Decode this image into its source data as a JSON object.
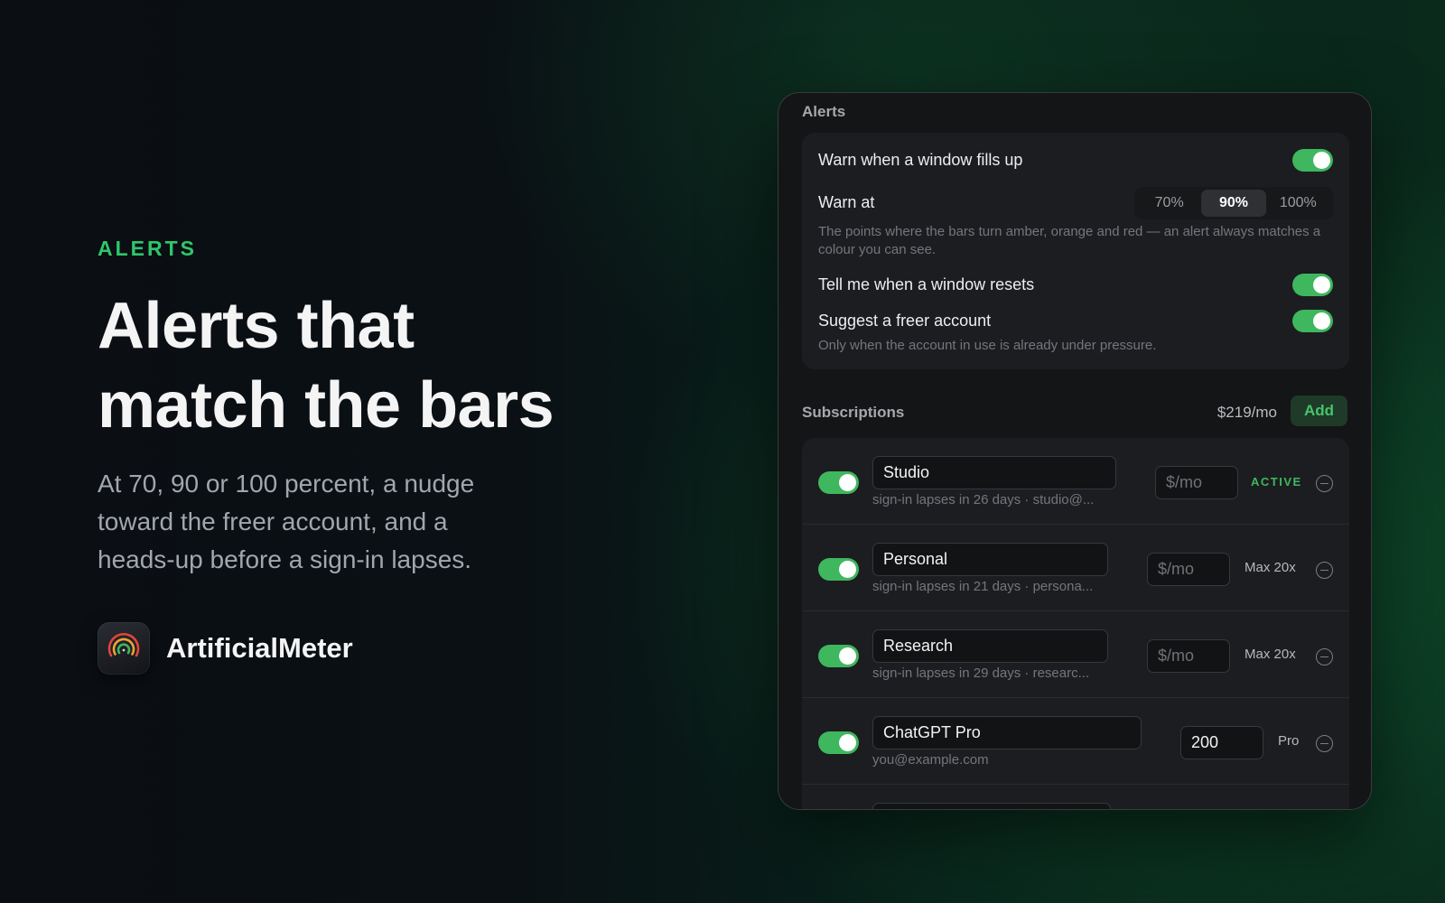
{
  "hero": {
    "eyebrow": "ALERTS",
    "headline_line1": "Alerts that",
    "headline_line2": "match the bars",
    "subhead": "At 70, 90 or 100 percent, a nudge toward the freer account, and a heads-up before a sign-in lapses.",
    "brand_name": "ArtificialMeter",
    "icon": "gauge-app-icon"
  },
  "alerts": {
    "section_title": "Alerts",
    "warn_fill": {
      "label": "Warn when a window fills up",
      "enabled": true
    },
    "warn_at": {
      "label": "Warn at",
      "options": [
        "70%",
        "90%",
        "100%"
      ],
      "selected": "90%",
      "help": "The points where the bars turn amber, orange and red — an alert always matches a colour you can see."
    },
    "reset_notice": {
      "label": "Tell me when a window resets",
      "enabled": true
    },
    "freer_account": {
      "label": "Suggest a freer account",
      "enabled": true,
      "help": "Only when the account in use is already under pressure."
    }
  },
  "subscriptions": {
    "section_title": "Subscriptions",
    "total": "$219/mo",
    "add_label": "Add",
    "price_placeholder": "$/mo",
    "items": [
      {
        "name": "Studio",
        "meta": "sign-in lapses in 26 days · studio@...",
        "price": "",
        "plan": "ACTIVE",
        "enabled": true
      },
      {
        "name": "Personal",
        "meta": "sign-in lapses in 21 days · persona...",
        "price": "",
        "plan": "Max 20x",
        "enabled": true
      },
      {
        "name": "Research",
        "meta": "sign-in lapses in 29 days · researc...",
        "price": "",
        "plan": "Max 20x",
        "enabled": true
      },
      {
        "name": "ChatGPT Pro",
        "meta": "you@example.com",
        "price": "200",
        "plan": "Pro",
        "enabled": true
      },
      {
        "name": "",
        "meta": "",
        "price": "",
        "plan": "",
        "enabled": true
      }
    ]
  },
  "colors": {
    "accent": "#3eb75e",
    "eyebrow": "#2fc66a"
  }
}
